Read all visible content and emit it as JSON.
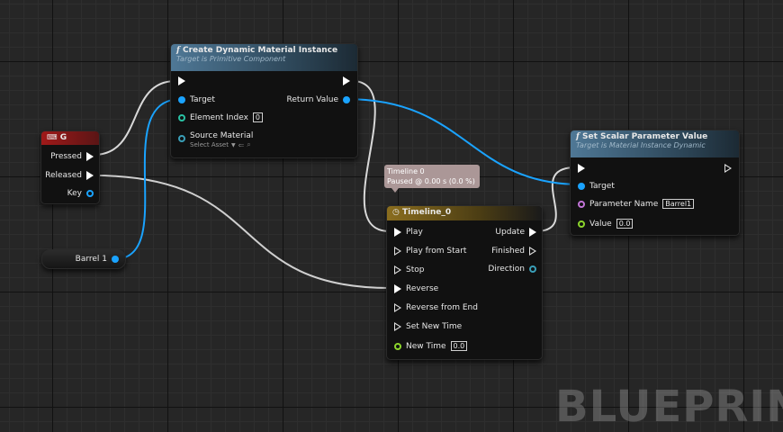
{
  "key_node": {
    "title": "G",
    "pins": [
      "Pressed",
      "Released",
      "Key"
    ]
  },
  "variable_node": {
    "label": "Barrel 1"
  },
  "cdmi_node": {
    "title": "Create Dynamic Material Instance",
    "subtitle": "Target is Primitive Component",
    "pins": {
      "target": "Target",
      "return_value": "Return Value",
      "element_index": "Element Index",
      "element_index_value": "0",
      "source_material": "Source Material",
      "select_asset": "Select Asset"
    }
  },
  "tooltip": {
    "line1": "Timeline 0",
    "line2": "Paused @ 0.00 s (0.0 %)"
  },
  "timeline_node": {
    "title": "Timeline_0",
    "inputs": [
      "Play",
      "Play from Start",
      "Stop",
      "Reverse",
      "Reverse from End",
      "Set New Time"
    ],
    "new_time_label": "New Time",
    "new_time_value": "0.0",
    "outputs": [
      "Update",
      "Finished",
      "Direction"
    ]
  },
  "sspv_node": {
    "title": "Set Scalar Parameter Value",
    "subtitle": "Target is Material Instance Dynamic",
    "pins": {
      "target": "Target",
      "param_name": "Parameter Name",
      "param_name_value": "Barrel1",
      "value": "Value",
      "value_value": "0.0"
    }
  },
  "watermark": "BLUEPRIN",
  "colors": {
    "exec": "#ffffff",
    "object": "#1aa3ff",
    "int": "#29c2a4",
    "float": "#8cd62c",
    "name": "#c274d8",
    "key_header": "#a01919",
    "function_header": "#4f7896",
    "timeline_header": "#8a6d1e"
  }
}
